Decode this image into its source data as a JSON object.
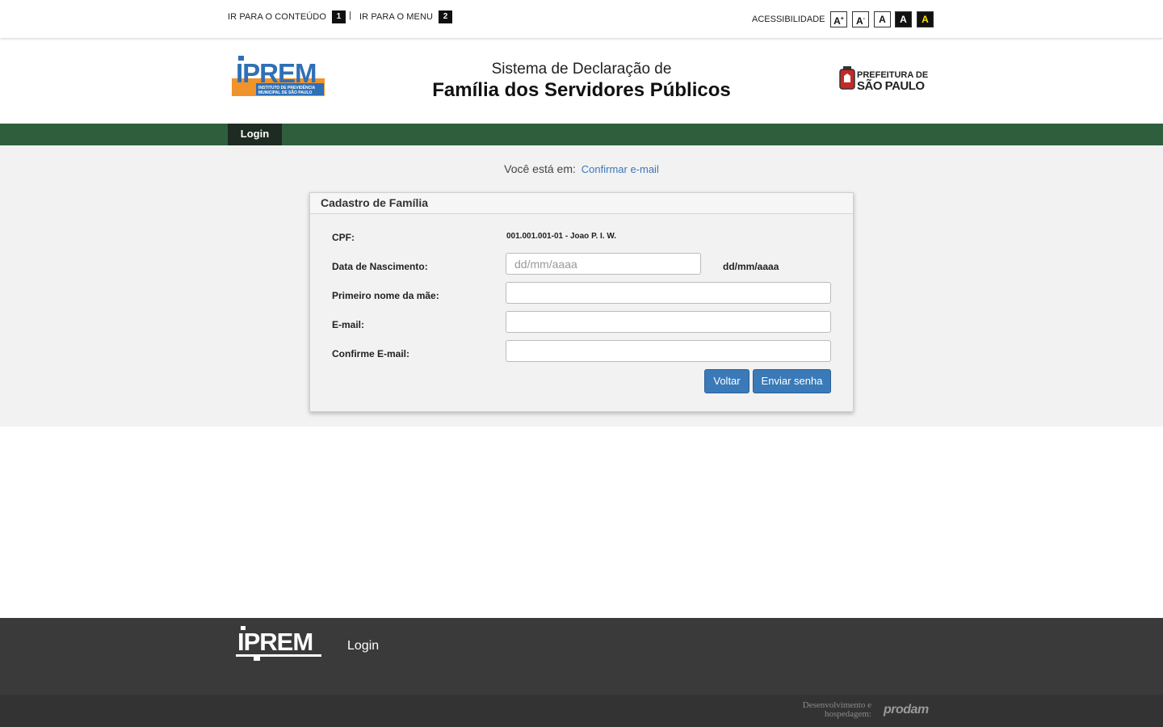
{
  "topbar": {
    "skip_content_label": "IR PARA O CONTEÚDO",
    "skip_content_key": "1",
    "separator": "|",
    "skip_menu_label": "IR PARA O MENU",
    "skip_menu_key": "2",
    "accessibility_label": "ACESSIBILIDADE",
    "buttons": {
      "increase": "A",
      "increase_sup": "+",
      "decrease": "A",
      "decrease_sup": "-",
      "normal": "A",
      "dark": "A",
      "contrast": "A"
    }
  },
  "header": {
    "logo_left_text": "IPREM",
    "logo_left_sub1": "INSTITUTO DE PREVIDÊNCIA",
    "logo_left_sub2": "MUNICIPAL DE SÃO PAULO",
    "title_line1": "Sistema de Declaração de",
    "title_line2": "Família dos Servidores Públicos",
    "logo_right_line1": "PREFEITURA DE",
    "logo_right_line2": "SÃO PAULO"
  },
  "nav": {
    "items": [
      {
        "label": "Login"
      }
    ]
  },
  "breadcrumb": {
    "prefix": "Você está em:",
    "current": "Confirmar e-mail"
  },
  "form": {
    "title": "Cadastro de Família",
    "cpf_label": "CPF:",
    "cpf_value": "001.001.001-01 - Joao P. I. W.",
    "birth_label": "Data de Nascimento:",
    "birth_placeholder": "dd/mm/aaaa",
    "birth_value": "",
    "birth_hint": "dd/mm/aaaa",
    "mother_label": "Primeiro nome da mãe:",
    "mother_value": "",
    "email_label": "E-mail:",
    "email_value": "",
    "email_confirm_label": "Confirme E-mail:",
    "email_confirm_value": "",
    "back_button": "Voltar",
    "submit_button": "Enviar senha"
  },
  "footer": {
    "logo_text": "IPREM",
    "login_link": "Login",
    "dev_text_line1": "Desenvolvimento e",
    "dev_text_line2": "hospedagem:",
    "dev_brand": "prodam"
  },
  "colors": {
    "nav_green": "#2f5e3d",
    "nav_active": "#1d2b22",
    "button_blue": "#3b7ab8",
    "link_blue": "#3a78b8",
    "iprem_blue": "#2f6fb5",
    "iprem_orange": "#f0932b",
    "footer_dark": "#3a3a3a"
  }
}
